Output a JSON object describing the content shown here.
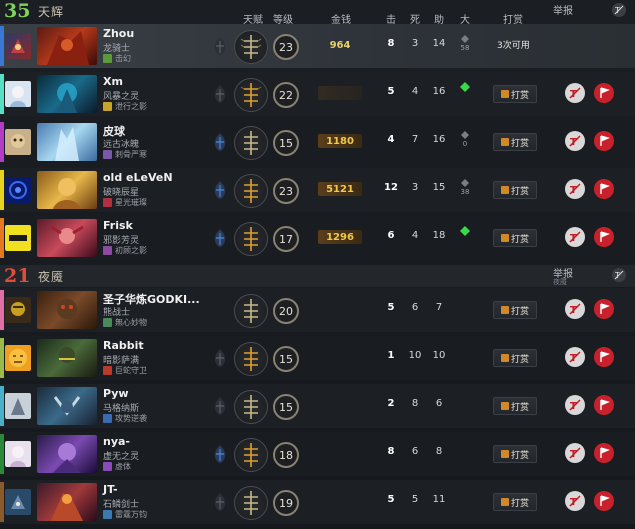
{
  "radiant": {
    "score": "35",
    "name": "天辉"
  },
  "dire": {
    "score": "21",
    "name": "夜魇"
  },
  "headers": {
    "talent": "天赋",
    "level": "等级",
    "gold": "金钱",
    "kills": "击",
    "deaths": "死",
    "assists": "助",
    "ultimate": "大",
    "tip": "打赏",
    "report": "举报",
    "report_sub": "夜魇"
  },
  "tip_label": "打赏",
  "rows": [
    {
      "name": "Zhou",
      "hero": "龙骑士",
      "facet": "击幻",
      "level": "23",
      "gold": "964",
      "k": "8",
      "d": "3",
      "a": "14",
      "ult": "58",
      "tip_text": "3次可用",
      "color": "#3a78d8",
      "facet_color": "#5a9a3a"
    },
    {
      "name": "Xm",
      "hero": "风暴之灵",
      "facet": "泄行之影",
      "level": "22",
      "gold": "",
      "k": "5",
      "d": "4",
      "a": "16",
      "ult": "",
      "color": "#59e0c4",
      "facet_color": "#c8a52a"
    },
    {
      "name": "皮球",
      "hero": "远古冰魄",
      "facet": "刺骨严寒",
      "level": "15",
      "gold": "1180",
      "k": "4",
      "d": "7",
      "a": "16",
      "ult": "0",
      "color": "#b33cc7",
      "facet_color": "#7a5aa8"
    },
    {
      "name": "old eLeVeN",
      "hero": "破晓辰星",
      "facet": "星光璀璨",
      "level": "23",
      "gold": "5121",
      "k": "12",
      "d": "3",
      "a": "15",
      "ult": "38",
      "color": "#e6d31f",
      "facet_color": "#b03040"
    },
    {
      "name": "Frisk",
      "hero": "邪影芳灵",
      "facet": "初顾之影",
      "level": "17",
      "gold": "1296",
      "k": "6",
      "d": "4",
      "a": "18",
      "ult": "",
      "color": "#e37a1f",
      "facet_color": "#8a4aa0"
    },
    {
      "name": "圣子华炼GODKI...",
      "hero": "熊战士",
      "facet": "無心妙物",
      "level": "20",
      "gold": "",
      "k": "5",
      "d": "6",
      "a": "7",
      "ult": "",
      "color": "#e36ea3",
      "facet_color": "#4a8a5a"
    },
    {
      "name": "Rabbit",
      "hero": "暗影萨满",
      "facet": "巨蛇守卫",
      "level": "15",
      "gold": "",
      "k": "1",
      "d": "10",
      "a": "10",
      "ult": "",
      "color": "#9aba4a",
      "facet_color": "#b83a2a"
    },
    {
      "name": "Pyw",
      "hero": "马格纳斯",
      "facet": "攻势逆袭",
      "level": "15",
      "gold": "",
      "k": "2",
      "d": "8",
      "a": "6",
      "ult": "",
      "color": "#48b0c8",
      "facet_color": "#3a6ab0"
    },
    {
      "name": "nya-",
      "hero": "虚无之灵",
      "facet": "虚体",
      "level": "18",
      "gold": "",
      "k": "8",
      "d": "6",
      "a": "8",
      "ult": "",
      "color": "#2a8a3a",
      "facet_color": "#8a4ab8"
    },
    {
      "name": "JT-",
      "hero": "石鳞剑士",
      "facet": "雷霆万钧",
      "level": "19",
      "gold": "",
      "k": "5",
      "d": "5",
      "a": "11",
      "ult": "",
      "color": "#8a5a2a",
      "facet_color": "#3a7ab0"
    }
  ]
}
